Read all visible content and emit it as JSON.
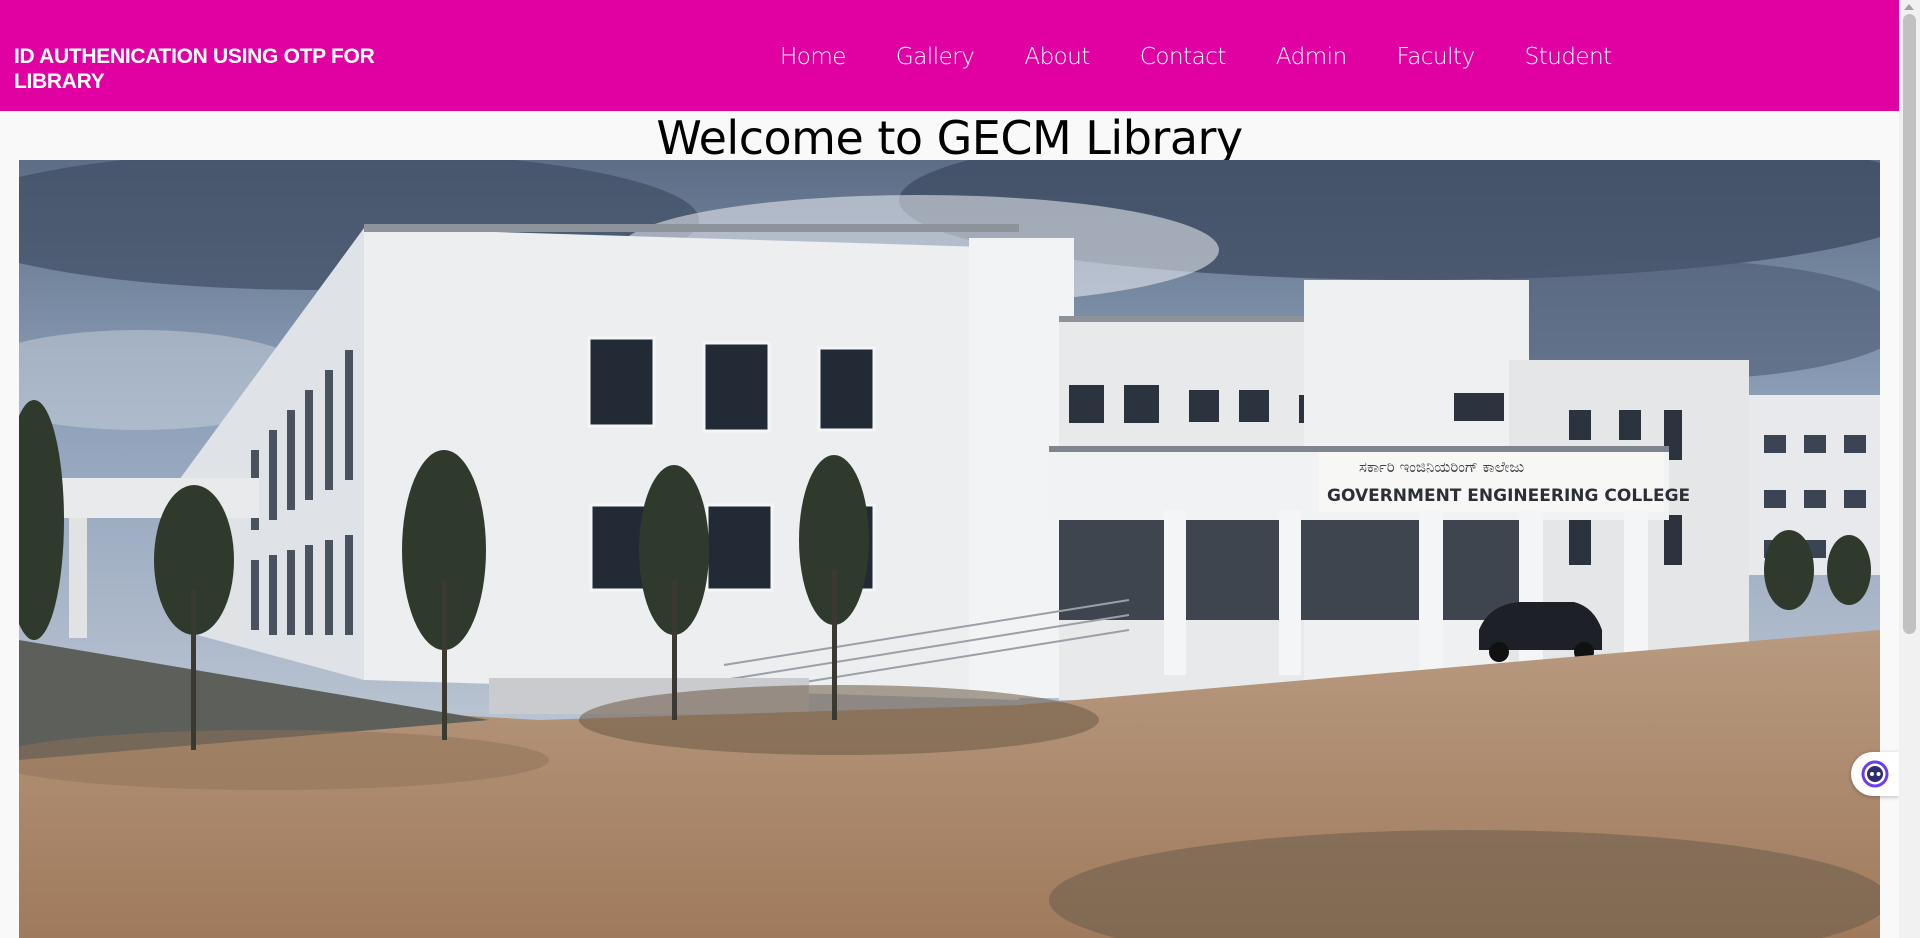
{
  "header": {
    "brand": "ID AUTHENICATION USING OTP FOR LIBRARY",
    "background_color": "#e100a2",
    "nav": [
      {
        "label": "Home"
      },
      {
        "label": "Gallery"
      },
      {
        "label": "About"
      },
      {
        "label": "Contact"
      },
      {
        "label": "Admin"
      },
      {
        "label": "Faculty"
      },
      {
        "label": "Student"
      }
    ]
  },
  "main": {
    "heading": "Welcome to GECM Library",
    "hero_image": {
      "sign_text": "GOVERNMENT ENGINEERING COLLEGE",
      "sign_kannada": "ಸರ್ಕಾರಿ ಇಂಜಿನಿಯರಿಂಗ್ ಕಾಲೇಜು"
    }
  },
  "widgets": {
    "chat_icon": "chat-assistant-icon"
  }
}
